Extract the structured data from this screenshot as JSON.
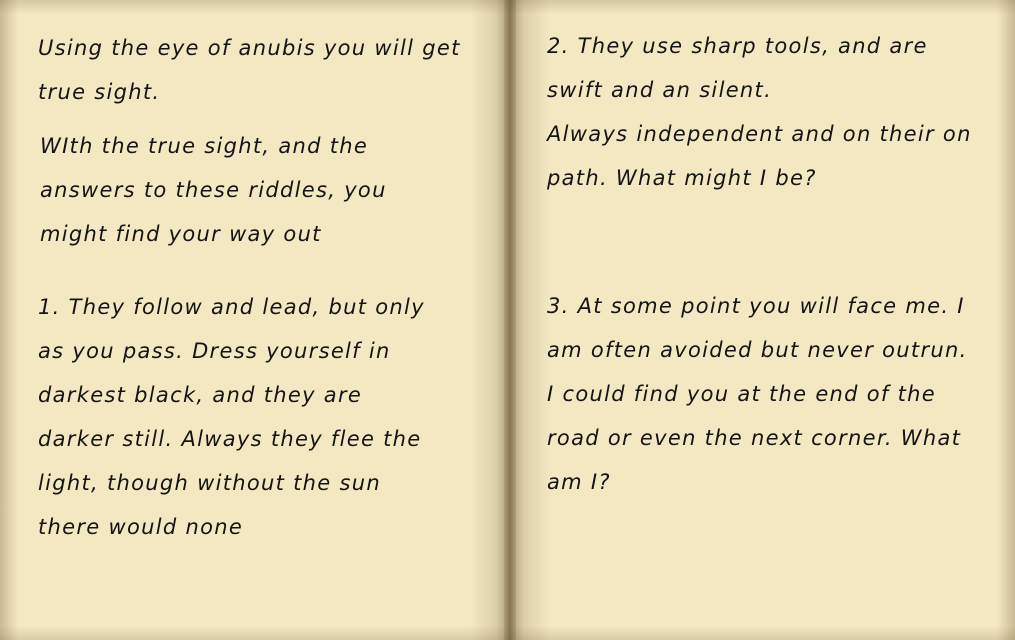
{
  "left_page": {
    "intro": [
      "Using the eye of anubis you will get",
      "true sight."
    ],
    "intro2": [
      "WIth the true sight, and the",
      "answers to these riddles, you",
      "might find your way out"
    ],
    "riddle1": [
      "1. They follow and lead, but only",
      "as you pass. Dress yourself in",
      "darkest black, and they are",
      "darker still. Always they flee the",
      "light, though without the sun",
      "there would none"
    ]
  },
  "right_page": {
    "riddle2": [
      "2.  They use sharp tools, and are",
      "swift and an silent.",
      "Always independent and on their on",
      "path. What might I be?"
    ],
    "riddle3": [
      "3. At some point you will face me. I",
      "am often avoided but never outrun.",
      "I could find you at the end of the",
      "road or even the next corner. What",
      "am I?"
    ]
  }
}
